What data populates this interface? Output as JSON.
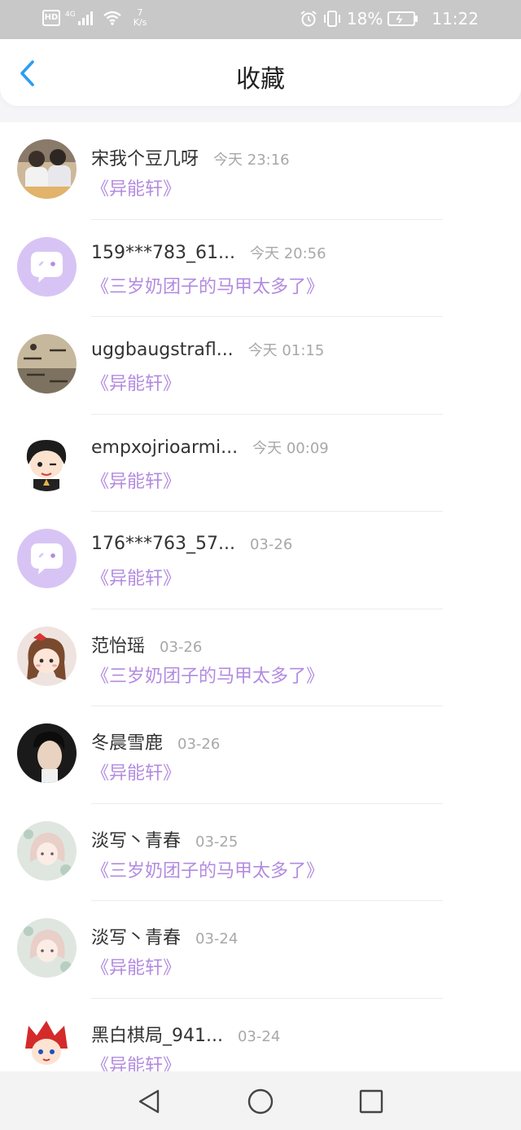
{
  "status": {
    "net_type": "4G",
    "speed_value": "7",
    "speed_unit": "K/s",
    "battery_percent": "18%",
    "time": "11:22",
    "hd_label": "HD"
  },
  "header": {
    "title": "收藏"
  },
  "favorites": [
    {
      "name": "宋我个豆几呀",
      "time": "今天 23:16",
      "book": "《异能轩》",
      "avatar": "photo"
    },
    {
      "name": "159***783_61...",
      "time": "今天 20:56",
      "book": "《三岁奶团子的马甲太多了》",
      "avatar": "default-bubble"
    },
    {
      "name": "uggbaugstrafl...",
      "time": "今天 01:15",
      "book": "《异能轩》",
      "avatar": "photo"
    },
    {
      "name": "empxojrioarmi...",
      "time": "今天 00:09",
      "book": "《异能轩》",
      "avatar": "cartoon"
    },
    {
      "name": "176***763_57...",
      "time": "03-26",
      "book": "《异能轩》",
      "avatar": "default-bubble"
    },
    {
      "name": "范怡瑶",
      "time": "03-26",
      "book": "《三岁奶团子的马甲太多了》",
      "avatar": "cartoon"
    },
    {
      "name": "冬晨雪鹿",
      "time": "03-26",
      "book": "《异能轩》",
      "avatar": "photo"
    },
    {
      "name": "淡写丶青春",
      "time": "03-25",
      "book": "《三岁奶团子的马甲太多了》",
      "avatar": "illustration"
    },
    {
      "name": "淡写丶青春",
      "time": "03-24",
      "book": "《异能轩》",
      "avatar": "illustration"
    },
    {
      "name": "黑白棋局_941...",
      "time": "03-24",
      "book": "《异能轩》",
      "avatar": "cartoon"
    }
  ],
  "colors": {
    "accent_link": "#b38be0",
    "back_arrow": "#2a9df4",
    "bubble_avatar_bg": "#d8c4f4"
  }
}
